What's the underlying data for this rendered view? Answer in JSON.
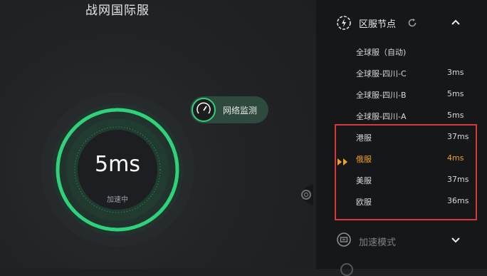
{
  "game": {
    "title": "战网国际服",
    "latency": "5ms",
    "status": "加速中",
    "monitor_label": "网络监测"
  },
  "node_panel": {
    "title": "区服节点",
    "nodes": [
      {
        "name": "全球服（自动)",
        "ms": ""
      },
      {
        "name": "全球服-四川-C",
        "ms": "3ms"
      },
      {
        "name": "全球服-四川-B",
        "ms": "5ms"
      },
      {
        "name": "全球服-四川-A",
        "ms": "5ms"
      },
      {
        "name": "港服",
        "ms": "37ms"
      },
      {
        "name": "俄服",
        "ms": "4ms",
        "active": true
      },
      {
        "name": "美服",
        "ms": "37ms"
      },
      {
        "name": "欧服",
        "ms": "36ms"
      }
    ]
  },
  "mode_panel": {
    "title": "加速模式"
  },
  "colors": {
    "accent_green": "#2fd27a",
    "active_orange": "#f2a023",
    "highlight_red": "#d9373a",
    "panel_bg": "#161719"
  },
  "icons": {
    "node_header": "globe-icon",
    "refresh": "refresh-icon",
    "collapse": "chevron-up-icon",
    "mode_header": "mode-icon",
    "expand": "chevron-down-icon",
    "settings": "gear-icon",
    "monitor": "gauge-icon",
    "active_node": "play-arrows-icon"
  }
}
